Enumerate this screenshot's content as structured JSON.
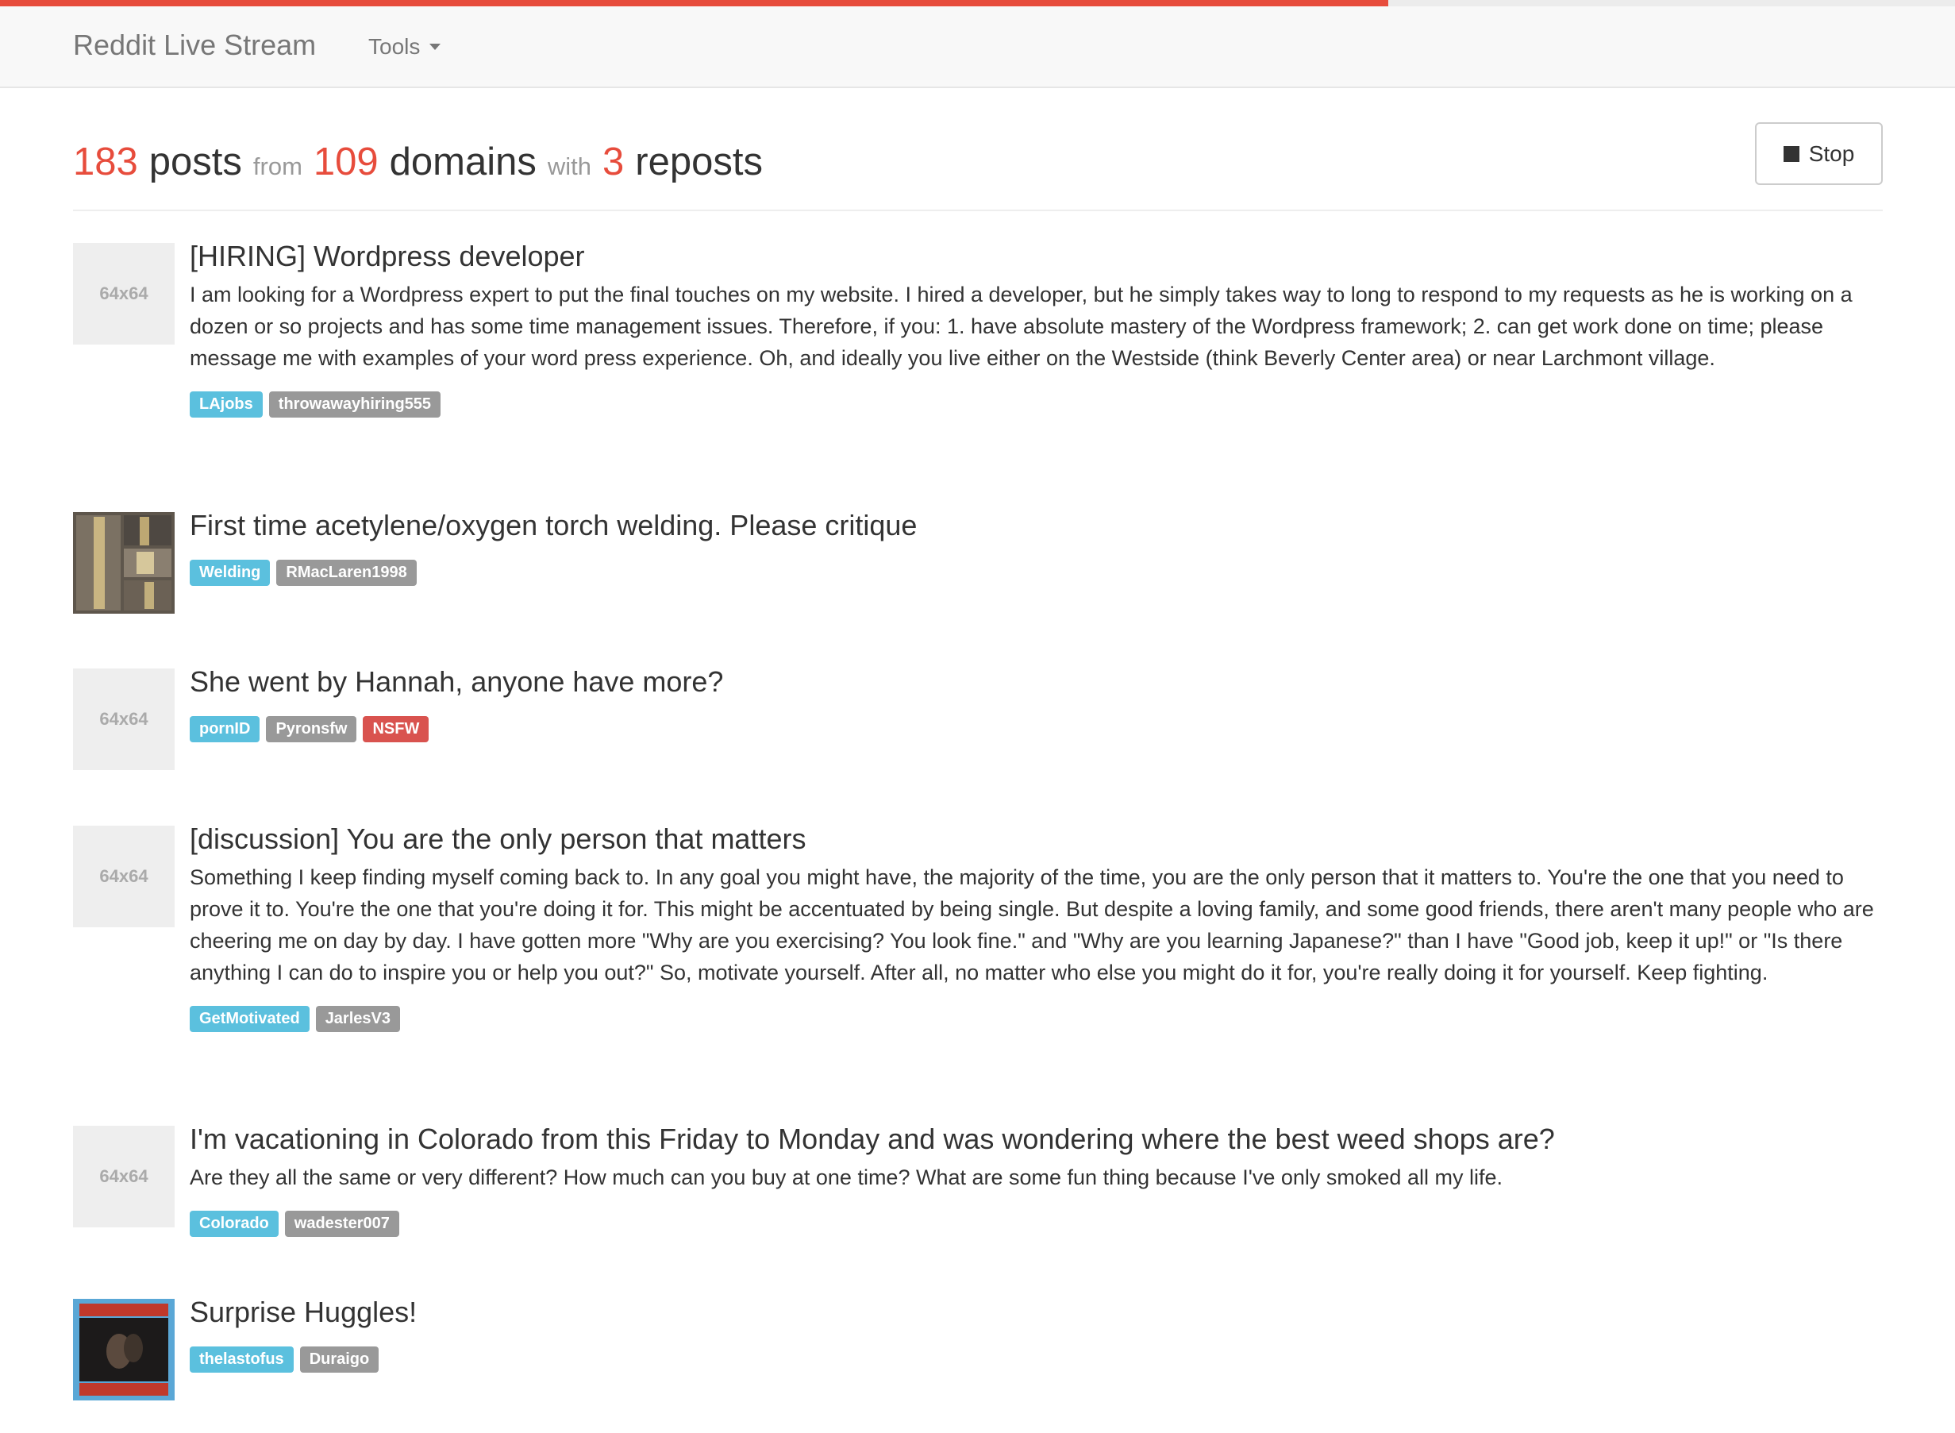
{
  "app": {
    "brand": "Reddit Live Stream",
    "tools_label": "Tools",
    "progress": 0.71
  },
  "summary": {
    "posts": "183",
    "posts_label": "posts",
    "from": "from",
    "domains": "109",
    "domains_label": "domains",
    "with": "with",
    "reposts": "3",
    "reposts_label": "reposts"
  },
  "stop_button": {
    "label": "Stop"
  },
  "colors": {
    "accent": "#e74c3c",
    "subreddit_tag": "#5bc0de",
    "user_tag": "#999999",
    "nsfw_tag": "#d9534f"
  },
  "posts": [
    {
      "thumb": "64x64",
      "title": "[HIRING] Wordpress developer",
      "text": "I am looking for a Wordpress expert to put the final touches on my website. I hired a developer, but he simply takes way to long to respond to my requests as he is working on a dozen or so projects and has some time management issues. Therefore, if you: 1. have absolute mastery of the Wordpress framework; 2. can get work done on time; please message me with examples of your word press experience. Oh, and ideally you live either on the Westside (think Beverly Center area) or near Larchmont village.",
      "subreddit": "LAjobs",
      "user": "throwawayhiring555"
    },
    {
      "thumb": "",
      "title": "First time acetylene/oxygen torch welding. Please critique",
      "text": "",
      "subreddit": "Welding",
      "user": "RMacLaren1998"
    },
    {
      "thumb": "64x64",
      "title": "She went by Hannah, anyone have more?",
      "text": "",
      "subreddit": "pornID",
      "user": "Pyronsfw",
      "nsfw": "NSFW"
    },
    {
      "thumb": "64x64",
      "title": "[discussion] You are the only person that matters",
      "text": "Something I keep finding myself coming back to. In any goal you might have, the majority of the time, you are the only person that it matters to. You're the one that you need to prove it to. You're the one that you're doing it for. This might be accentuated by being single. But despite a loving family, and some good friends, there aren't many people who are cheering me on day by day. I have gotten more \"Why are you exercising? You look fine.\" and \"Why are you learning Japanese?\" than I have \"Good job, keep it up!\" or \"Is there anything I can do to inspire you or help you out?\" So, motivate yourself. After all, no matter who else you might do it for, you're really doing it for yourself. Keep fighting.",
      "subreddit": "GetMotivated",
      "user": "JarlesV3"
    },
    {
      "thumb": "64x64",
      "title": "I'm vacationing in Colorado from this Friday to Monday and was wondering where the best weed shops are?",
      "text": "Are they all the same or very different? How much can you buy at one time? What are some fun thing because I've only smoked all my life.",
      "subreddit": "Colorado",
      "user": "wadester007"
    },
    {
      "thumb": "",
      "title": "Surprise Huggles!",
      "text": "",
      "subreddit": "thelastofus",
      "user": "Duraigo"
    }
  ]
}
